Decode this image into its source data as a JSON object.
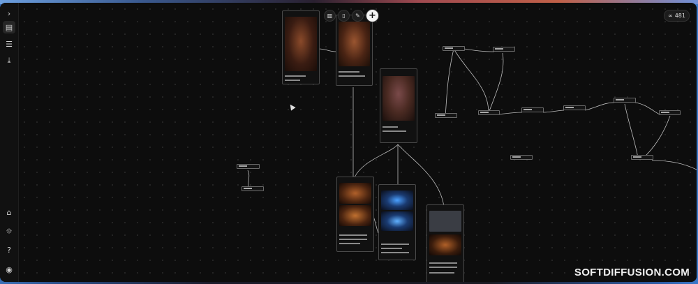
{
  "toolbar": {
    "add_label": "+"
  },
  "badge": {
    "count": "481",
    "icon": "link-icon"
  },
  "sidebar": {
    "items": [
      {
        "name": "expand",
        "glyph": "›"
      },
      {
        "name": "library",
        "glyph": "▤"
      },
      {
        "name": "settings-sliders",
        "glyph": "☰"
      },
      {
        "name": "download",
        "glyph": "⤓"
      },
      {
        "name": "home",
        "glyph": "⌂"
      },
      {
        "name": "theme",
        "glyph": "☼"
      },
      {
        "name": "help",
        "glyph": "?"
      },
      {
        "name": "avatar",
        "glyph": "◉"
      }
    ]
  },
  "watermark": "SOFTDIFFUSION.COM",
  "colors": {
    "canvas": "#0d0d0d",
    "card_border": "#4a4a4a",
    "wire": "#bdbdbd"
  }
}
